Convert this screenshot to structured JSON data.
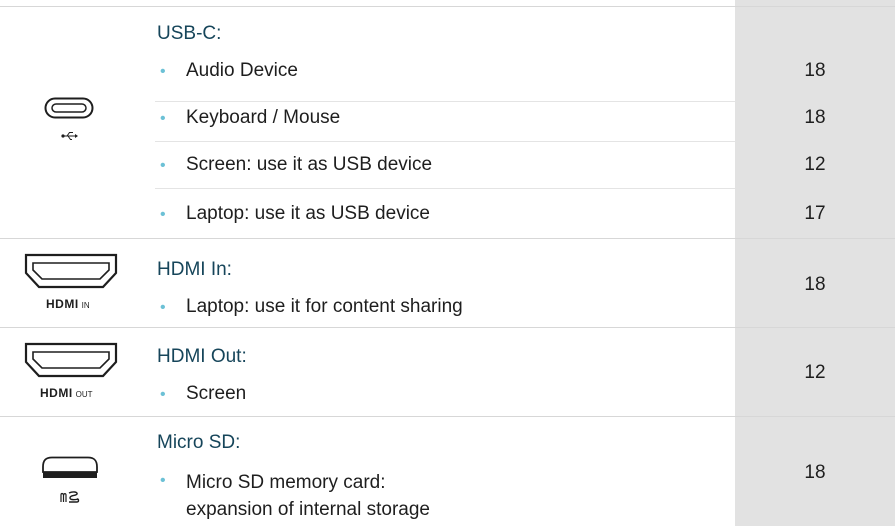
{
  "sections": [
    {
      "title": "USB-C:",
      "icon": "usb-c-port-icon",
      "caption_main": "",
      "caption_sub": "",
      "items": [
        {
          "label": "Audio Device",
          "value": "18"
        },
        {
          "label": "Keyboard / Mouse",
          "value": "18"
        },
        {
          "label": "Screen: use it as USB device",
          "value": "12"
        },
        {
          "label": "Laptop: use it as USB device",
          "value": "17"
        }
      ]
    },
    {
      "title": "HDMI In:",
      "icon": "hdmi-port-icon",
      "caption_main": "HDMI",
      "caption_sub": "IN",
      "items": [
        {
          "label": "Laptop: use it for content sharing",
          "value": "18"
        }
      ]
    },
    {
      "title": "HDMI Out:",
      "icon": "hdmi-port-icon",
      "caption_main": "HDMI",
      "caption_sub": "OUT",
      "items": [
        {
          "label": "Screen",
          "value": "12"
        }
      ]
    },
    {
      "title": "Micro SD:",
      "icon": "micro-sd-slot-icon",
      "caption_main": "",
      "caption_sub": "",
      "items": [
        {
          "label_lines": [
            "Micro SD memory card:",
            "expansion of internal storage"
          ],
          "value": "18"
        }
      ]
    }
  ],
  "colors": {
    "title": "#16455a",
    "bullet": "#6cc1d6",
    "value_column": "#e2e2e2",
    "divider": "#d7d7d7"
  }
}
